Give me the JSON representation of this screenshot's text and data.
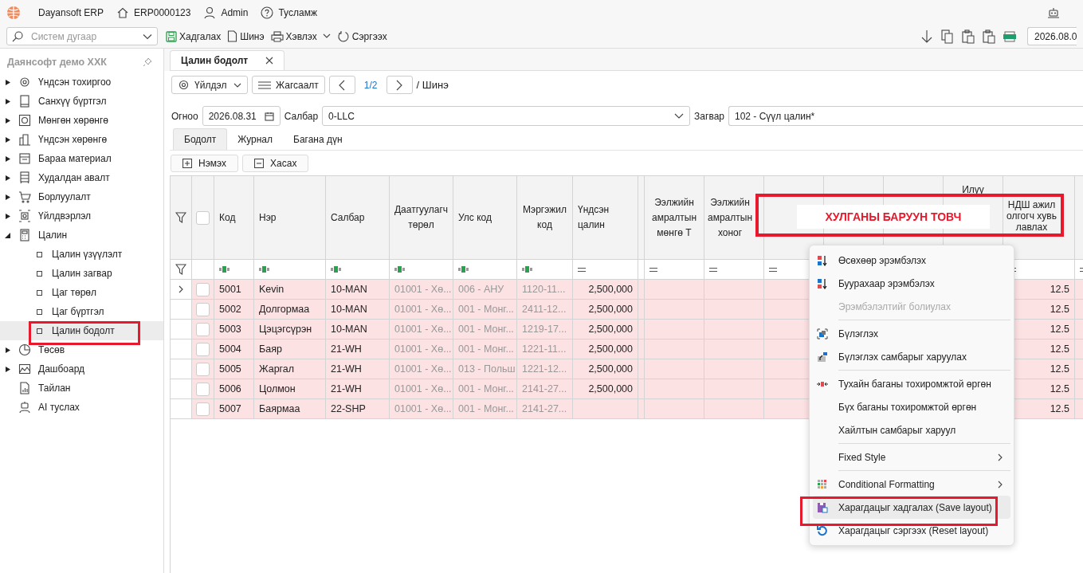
{
  "app_bar": {
    "title": "Dayansoft ERP",
    "company_code": "ERP0000123",
    "user": "Admin",
    "help": "Тусламж"
  },
  "toolbar": {
    "search_placeholder": "Систем дугаар",
    "buttons": [
      "Хадгалах",
      "Шинэ",
      "Хэвлэх",
      "Сэргээх"
    ],
    "date": "2026.08.0"
  },
  "sidebar": {
    "title": "Даянсофт демо ХХК",
    "items": [
      {
        "label": "Үндсэн тохиргоо",
        "kind": "group",
        "expanded": false,
        "selected": false
      },
      {
        "label": "Санхүү бүртгэл",
        "kind": "group",
        "expanded": false,
        "selected": false
      },
      {
        "label": "Мөнгөн хөрөнгө",
        "kind": "group",
        "expanded": false,
        "selected": false
      },
      {
        "label": "Үндсэн хөрөнгө",
        "kind": "group",
        "expanded": false,
        "selected": false
      },
      {
        "label": "Бараа материал",
        "kind": "group",
        "expanded": false,
        "selected": false
      },
      {
        "label": "Худалдан авалт",
        "kind": "group",
        "expanded": false,
        "selected": false
      },
      {
        "label": "Борлуулалт",
        "kind": "group",
        "expanded": false,
        "selected": false
      },
      {
        "label": "Үйлдвэрлэл",
        "kind": "group",
        "expanded": false,
        "selected": false
      },
      {
        "label": "Цалин",
        "kind": "group",
        "expanded": true,
        "selected": false,
        "children": [
          {
            "label": "Цалин үзүүлэлт",
            "selected": false
          },
          {
            "label": "Цалин загвар",
            "selected": false
          },
          {
            "label": "Цаг төрөл",
            "selected": false
          },
          {
            "label": "Цаг бүртгэл",
            "selected": false
          },
          {
            "label": "Цалин бодолт",
            "selected": true
          }
        ]
      },
      {
        "label": "Төсөв",
        "kind": "group",
        "expanded": false,
        "selected": false
      },
      {
        "label": "Дашбоард",
        "kind": "group",
        "expanded": false,
        "selected": false
      },
      {
        "label": "Тайлан",
        "kind": "page",
        "selected": false
      },
      {
        "label": "AI туслах",
        "kind": "page",
        "selected": false
      }
    ]
  },
  "document_tabs": [
    {
      "label": "Цалин бодолт",
      "selected": true
    }
  ],
  "action_bar": {
    "action": "Үйлдэл",
    "list": "Жагсаалт",
    "page": "1/2",
    "record": "/ Шинэ"
  },
  "form": [
    {
      "label": "Огноо",
      "value": "2026.08.31",
      "kind": "date"
    },
    {
      "label": "Салбар",
      "value": "0-LLC",
      "kind": "select"
    },
    {
      "label": "Загвар",
      "value": "102 - Сүүл цалин*",
      "kind": "text"
    }
  ],
  "sub_tabs": [
    {
      "label": "Бодолт",
      "selected": true
    },
    {
      "label": "Журнал",
      "selected": false
    },
    {
      "label": "Багана дүн",
      "selected": false
    }
  ],
  "grid_buttons": [
    "Нэмэх",
    "Хасах"
  ],
  "table": {
    "select_all_checked": false,
    "columns": [
      "Код",
      "Нэр",
      "Салбар",
      "Даатгуулагч төрөл",
      "Улс код",
      "Мэргэжил код",
      "Үндсэн цалин",
      "Ээлжийн амралтын мөнгө Т",
      "Ээлжийн амралтын хоног",
      null,
      null,
      null,
      "Илүү",
      "НДШ ажил олгогч хувь лавлах",
      null
    ],
    "rows": [
      {
        "selected": true,
        "checked": false,
        "cells": [
          "5001",
          "Kevin",
          "10-MAN",
          "01001 - Хө...",
          "006 - АНУ",
          "1120-11...",
          "2,500,000",
          null,
          null,
          null,
          null,
          null,
          null,
          "12.5",
          null
        ]
      },
      {
        "selected": false,
        "checked": false,
        "cells": [
          "5002",
          "Долгормаа",
          "10-MAN",
          "01001 - Хө...",
          "001 - Монг...",
          "2411-12...",
          "2,500,000",
          null,
          null,
          null,
          null,
          null,
          null,
          "12.5",
          null
        ]
      },
      {
        "selected": false,
        "checked": false,
        "cells": [
          "5003",
          "Цэцэгсүрэн",
          "10-MAN",
          "01001 - Хө...",
          "001 - Монг...",
          "1219-17...",
          "2,500,000",
          null,
          null,
          null,
          null,
          null,
          null,
          "12.5",
          null
        ]
      },
      {
        "selected": false,
        "checked": false,
        "cells": [
          "5004",
          "Баяр",
          "21-WH",
          "01001 - Хө...",
          "001 - Монг...",
          "1221-11...",
          "2,500,000",
          null,
          null,
          null,
          null,
          null,
          null,
          "12.5",
          null
        ]
      },
      {
        "selected": false,
        "checked": false,
        "cells": [
          "5005",
          "Жаргал",
          "21-WH",
          "01001 - Хө...",
          "013 - Польш",
          "1221-12...",
          "2,500,000",
          null,
          null,
          null,
          null,
          null,
          null,
          "12.5",
          null
        ]
      },
      {
        "selected": false,
        "checked": false,
        "cells": [
          "5006",
          "Цолмон",
          "21-WH",
          "01001 - Хө...",
          "001 - Монг...",
          "2141-27...",
          "2,500,000",
          null,
          null,
          null,
          null,
          null,
          null,
          "12.5",
          null
        ]
      },
      {
        "selected": false,
        "checked": false,
        "cells": [
          "5007",
          "Баярмаа",
          "22-SHP",
          "01001 - Хө...",
          "001 - Монг...",
          "2141-27...",
          null,
          null,
          null,
          null,
          null,
          null,
          null,
          "12.5",
          null
        ]
      }
    ]
  },
  "callout": {
    "text": "ХУЛГАНЫ БАРУУН ТОВЧ"
  },
  "context_menu": [
    {
      "kind": "item",
      "label": "Өсөхөөр эрэмбэлэх",
      "disabled": false,
      "submenu": false,
      "selected": false
    },
    {
      "kind": "item",
      "label": "Буурахаар эрэмбэлэх",
      "disabled": false,
      "submenu": false,
      "selected": false
    },
    {
      "kind": "item",
      "label": "Эрэмбэлэлтийг болиулах",
      "disabled": true,
      "submenu": false,
      "selected": false
    },
    {
      "kind": "separator"
    },
    {
      "kind": "item",
      "label": "Бүлэглэх",
      "disabled": false,
      "submenu": false,
      "selected": false
    },
    {
      "kind": "item",
      "label": "Бүлэглэх самбарыг харуулах",
      "disabled": false,
      "submenu": false,
      "selected": false
    },
    {
      "kind": "separator"
    },
    {
      "kind": "item",
      "label": "Тухайн баганы тохиромжтой өргөн",
      "disabled": false,
      "submenu": false,
      "selected": false
    },
    {
      "kind": "item",
      "label": "Бүх баганы тохиромжтой өргөн",
      "disabled": false,
      "submenu": false,
      "selected": false
    },
    {
      "kind": "item",
      "label": "Хайлтын самбарыг харуул",
      "disabled": false,
      "submenu": false,
      "selected": false
    },
    {
      "kind": "separator"
    },
    {
      "kind": "item",
      "label": "Fixed Style",
      "disabled": false,
      "submenu": true,
      "selected": false
    },
    {
      "kind": "separator"
    },
    {
      "kind": "item",
      "label": "Conditional Formatting",
      "disabled": false,
      "submenu": true,
      "selected": false
    },
    {
      "kind": "item",
      "label": "Харагдацыг хадгалах (Save layout)",
      "disabled": false,
      "submenu": false,
      "selected": true
    },
    {
      "kind": "item",
      "label": "Харагдацыг сэргээх (Reset layout)",
      "disabled": false,
      "submenu": false,
      "selected": false
    }
  ]
}
